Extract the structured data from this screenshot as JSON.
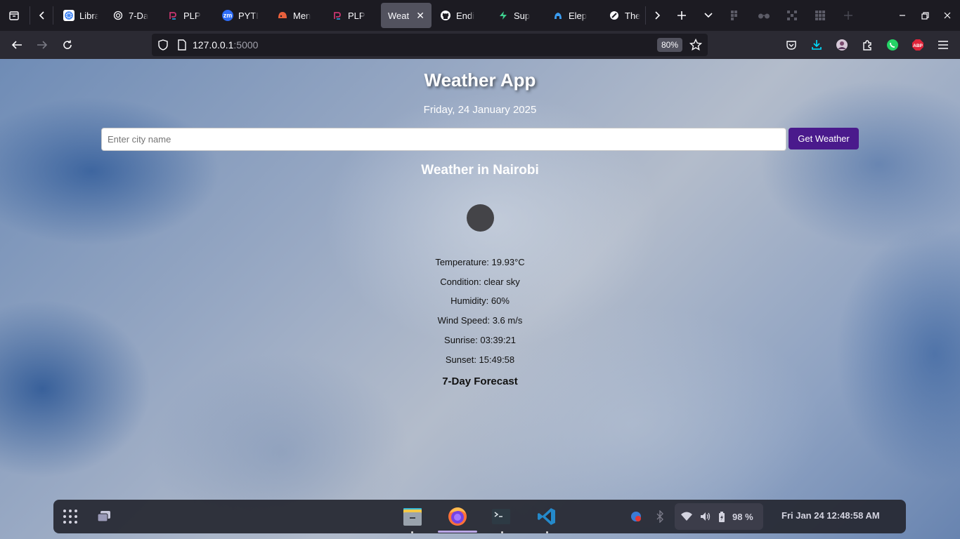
{
  "browser": {
    "tabs": [
      {
        "label": "Libra",
        "fav_color": "#3b82f6",
        "icon": "library-favicon"
      },
      {
        "label": "7-Da",
        "fav_color": "#1c1b22",
        "icon": "chatgpt-favicon"
      },
      {
        "label": "PLP",
        "fav_color": "#1c1b22",
        "icon": "plp-favicon"
      },
      {
        "label": "PYTI",
        "fav_color": "#2d6cf6",
        "icon": "zoom-favicon",
        "fav_text": "zm"
      },
      {
        "label": "Men",
        "fav_color": "#e8603c",
        "icon": "mentor-favicon"
      },
      {
        "label": "PLP",
        "fav_color": "#1c1b22",
        "icon": "plp-favicon"
      },
      {
        "label": "Weatl",
        "fav_color": "",
        "icon": "",
        "active": true
      },
      {
        "label": "Endi",
        "fav_color": "#1c1b22",
        "icon": "github-favicon"
      },
      {
        "label": "Sup",
        "fav_color": "#1c1b22",
        "icon": "supabase-favicon"
      },
      {
        "label": "Elep",
        "fav_color": "#1c1b22",
        "icon": "elephant-favicon"
      },
      {
        "label": "The",
        "fav_color": "#1c1b22",
        "icon": "dark-circle-favicon"
      }
    ],
    "url_host": "127.0.0.1",
    "url_port": ":5000",
    "zoom": "80%"
  },
  "page": {
    "title": "Weather App",
    "date": "Friday, 24 January 2025",
    "search": {
      "placeholder": "Enter city name",
      "value": ""
    },
    "button_label": "Get Weather",
    "weather_heading": "Weather in Nairobi",
    "details": {
      "temperature": "Temperature: 19.93°C",
      "condition": "Condition: clear sky",
      "humidity": "Humidity: 60%",
      "wind": "Wind Speed: 3.6 m/s",
      "sunrise": "Sunrise: 03:39:21",
      "sunset": "Sunset: 15:49:58"
    },
    "forecast_heading": "7-Day Forecast"
  },
  "taskbar": {
    "battery": "98 %",
    "clock": "Fri Jan 24  12:48:58 AM"
  },
  "colors": {
    "accent_button": "#4a1a8c",
    "browser_chrome": "#1c1b22",
    "active_tab": "#52525e"
  }
}
